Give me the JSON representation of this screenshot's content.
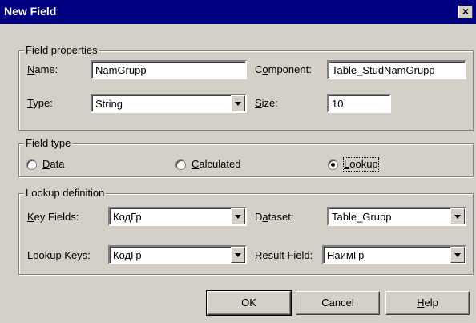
{
  "window": {
    "title": "New Field",
    "close_glyph": "×"
  },
  "field_properties": {
    "legend": "Field properties",
    "name": {
      "mnemonic": "N",
      "rest": "ame:",
      "value": "NamGrupp"
    },
    "component": {
      "pre": "C",
      "mnemonic": "o",
      "rest": "mponent:",
      "value": "Table_StudNamGrupp"
    },
    "type": {
      "mnemonic": "T",
      "rest": "ype:",
      "value": "String"
    },
    "size": {
      "mnemonic": "S",
      "rest": "ize:",
      "value": "10"
    }
  },
  "field_type": {
    "legend": "Field type",
    "options": [
      {
        "mnemonic": "D",
        "rest": "ata",
        "checked": false
      },
      {
        "mnemonic": "C",
        "rest": "alculated",
        "checked": false
      },
      {
        "mnemonic": "L",
        "rest": "ookup",
        "checked": true
      }
    ]
  },
  "lookup_definition": {
    "legend": "Lookup definition",
    "key_fields": {
      "mnemonic": "K",
      "rest": "ey Fields:",
      "value": "КодГр"
    },
    "dataset": {
      "pre": "D",
      "mnemonic": "a",
      "rest": "taset:",
      "value": "Table_Grupp"
    },
    "lookup_keys": {
      "pre": "Look",
      "mnemonic": "u",
      "rest": "p Keys:",
      "value": "КодГр"
    },
    "result_field": {
      "mnemonic": "R",
      "rest": "esult Field:",
      "value": "НаимГр"
    }
  },
  "buttons": {
    "ok": "OK",
    "cancel": "Cancel",
    "help": {
      "mnemonic": "H",
      "rest": "elp"
    }
  },
  "icons": {
    "combo_arrow": "chevron-down-icon",
    "close": "close-icon"
  }
}
